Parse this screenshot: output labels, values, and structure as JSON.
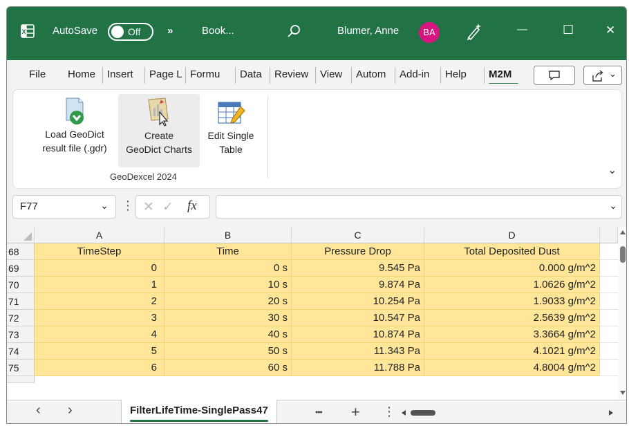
{
  "titlebar": {
    "autosave_label": "AutoSave",
    "autosave_state": "Off",
    "overflow_glyph": "»",
    "doc_name": "Book...",
    "user_name": "Blumer, Anne",
    "user_initials": "BA",
    "minimize_glyph": "—",
    "maximize_glyph": "☐",
    "close_glyph": "✕",
    "accent": "#217346",
    "avatar_color": "#d6167e"
  },
  "tabs": [
    {
      "label": "File"
    },
    {
      "label": "Home"
    },
    {
      "label": "Insert"
    },
    {
      "label": "Page L"
    },
    {
      "label": "Formu"
    },
    {
      "label": "Data"
    },
    {
      "label": "Review"
    },
    {
      "label": "View"
    },
    {
      "label": "Autom"
    },
    {
      "label": "Add-in"
    },
    {
      "label": "Help"
    },
    {
      "label": "M2M"
    }
  ],
  "ribbon": {
    "buttons": [
      {
        "line1": "Load GeoDict",
        "line2": "result file (.gdr)"
      },
      {
        "line1": "Create",
        "line2": "GeoDict Charts"
      },
      {
        "line1": "Edit Single",
        "line2": "Table"
      }
    ],
    "group_label": "GeoDexcel 2024",
    "collapse_glyph": "⌄"
  },
  "formula_bar": {
    "name_box": "F77",
    "fx_label": "fx",
    "formula_value": ""
  },
  "grid": {
    "columns": [
      "A",
      "B",
      "C",
      "D"
    ],
    "rows": [
      {
        "num": "68",
        "cells": [
          "TimeStep",
          "Time",
          "Pressure Drop",
          "Total Deposited Dust"
        ]
      },
      {
        "num": "69",
        "cells": [
          "0",
          "0 s",
          "9.545 Pa",
          "0.000 g/m^2"
        ]
      },
      {
        "num": "70",
        "cells": [
          "1",
          "10 s",
          "9.874 Pa",
          "1.0626 g/m^2"
        ]
      },
      {
        "num": "71",
        "cells": [
          "2",
          "20 s",
          "10.254 Pa",
          "1.9033 g/m^2"
        ]
      },
      {
        "num": "72",
        "cells": [
          "3",
          "30 s",
          "10.547 Pa",
          "2.5639 g/m^2"
        ]
      },
      {
        "num": "73",
        "cells": [
          "4",
          "40 s",
          "10.874 Pa",
          "3.3664 g/m^2"
        ]
      },
      {
        "num": "74",
        "cells": [
          "5",
          "50 s",
          "11.343 Pa",
          "4.1021 g/m^2"
        ]
      },
      {
        "num": "75",
        "cells": [
          "6",
          "60 s",
          "11.788 Pa",
          "4.8004 g/m^2"
        ]
      }
    ],
    "cell_fill": "#ffe699"
  },
  "sheetbar": {
    "prev_glyph": "‹",
    "next_glyph": "›",
    "active_sheet": "FilterLifeTime-SinglePass47",
    "more_glyph": "•••",
    "add_glyph": "+",
    "options_glyph": "⋮"
  }
}
